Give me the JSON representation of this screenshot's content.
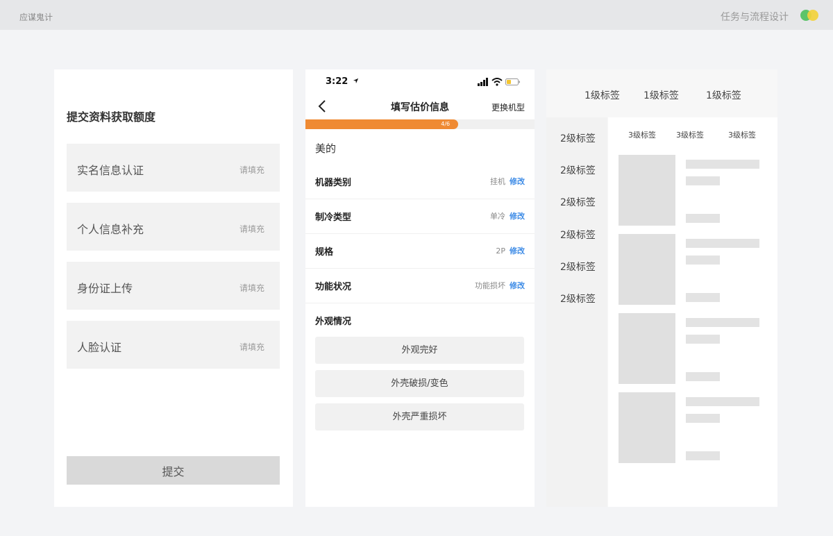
{
  "header": {
    "brand": "应谋鬼计",
    "title": "任务与流程设计",
    "accent_colors": [
      "#5cc46a",
      "#f3d23c"
    ]
  },
  "form_panel": {
    "title": "提交资料获取额度",
    "fields": [
      {
        "label": "实名信息认证",
        "placeholder": "请填充"
      },
      {
        "label": "个人信息补充",
        "placeholder": "请填充"
      },
      {
        "label": "身份证上传",
        "placeholder": "请填充"
      },
      {
        "label": "人脸认证",
        "placeholder": "请填充"
      }
    ],
    "submit_label": "提交"
  },
  "phone_panel": {
    "status_bar": {
      "time": "3:22"
    },
    "nav": {
      "title": "填写估价信息",
      "action": "更换机型"
    },
    "progress": {
      "current": 4,
      "total": 6,
      "text": "4/6",
      "fraction": 0.667,
      "color": "#ef8a33"
    },
    "brand": "美的",
    "specs": [
      {
        "label": "机器类别",
        "value": "挂机",
        "edit": "修改"
      },
      {
        "label": "制冷类型",
        "value": "单冷",
        "edit": "修改"
      },
      {
        "label": "规格",
        "value": "2P",
        "edit": "修改"
      },
      {
        "label": "功能状况",
        "value": "功能损坏",
        "edit": "修改"
      }
    ],
    "edit_color": "#3d8be6",
    "condition": {
      "label": "外观情况",
      "options": [
        "外观完好",
        "外壳破损/变色",
        "外壳严重损坏"
      ]
    }
  },
  "category_panel": {
    "level1_tabs": [
      "1级标签",
      "1级标签",
      "1级标签"
    ],
    "level2_items": [
      "2级标签",
      "2级标签",
      "2级标签",
      "2级标签",
      "2级标签",
      "2级标签"
    ],
    "level3_tabs": [
      "3级标签",
      "3级标签",
      "3级标签"
    ]
  }
}
